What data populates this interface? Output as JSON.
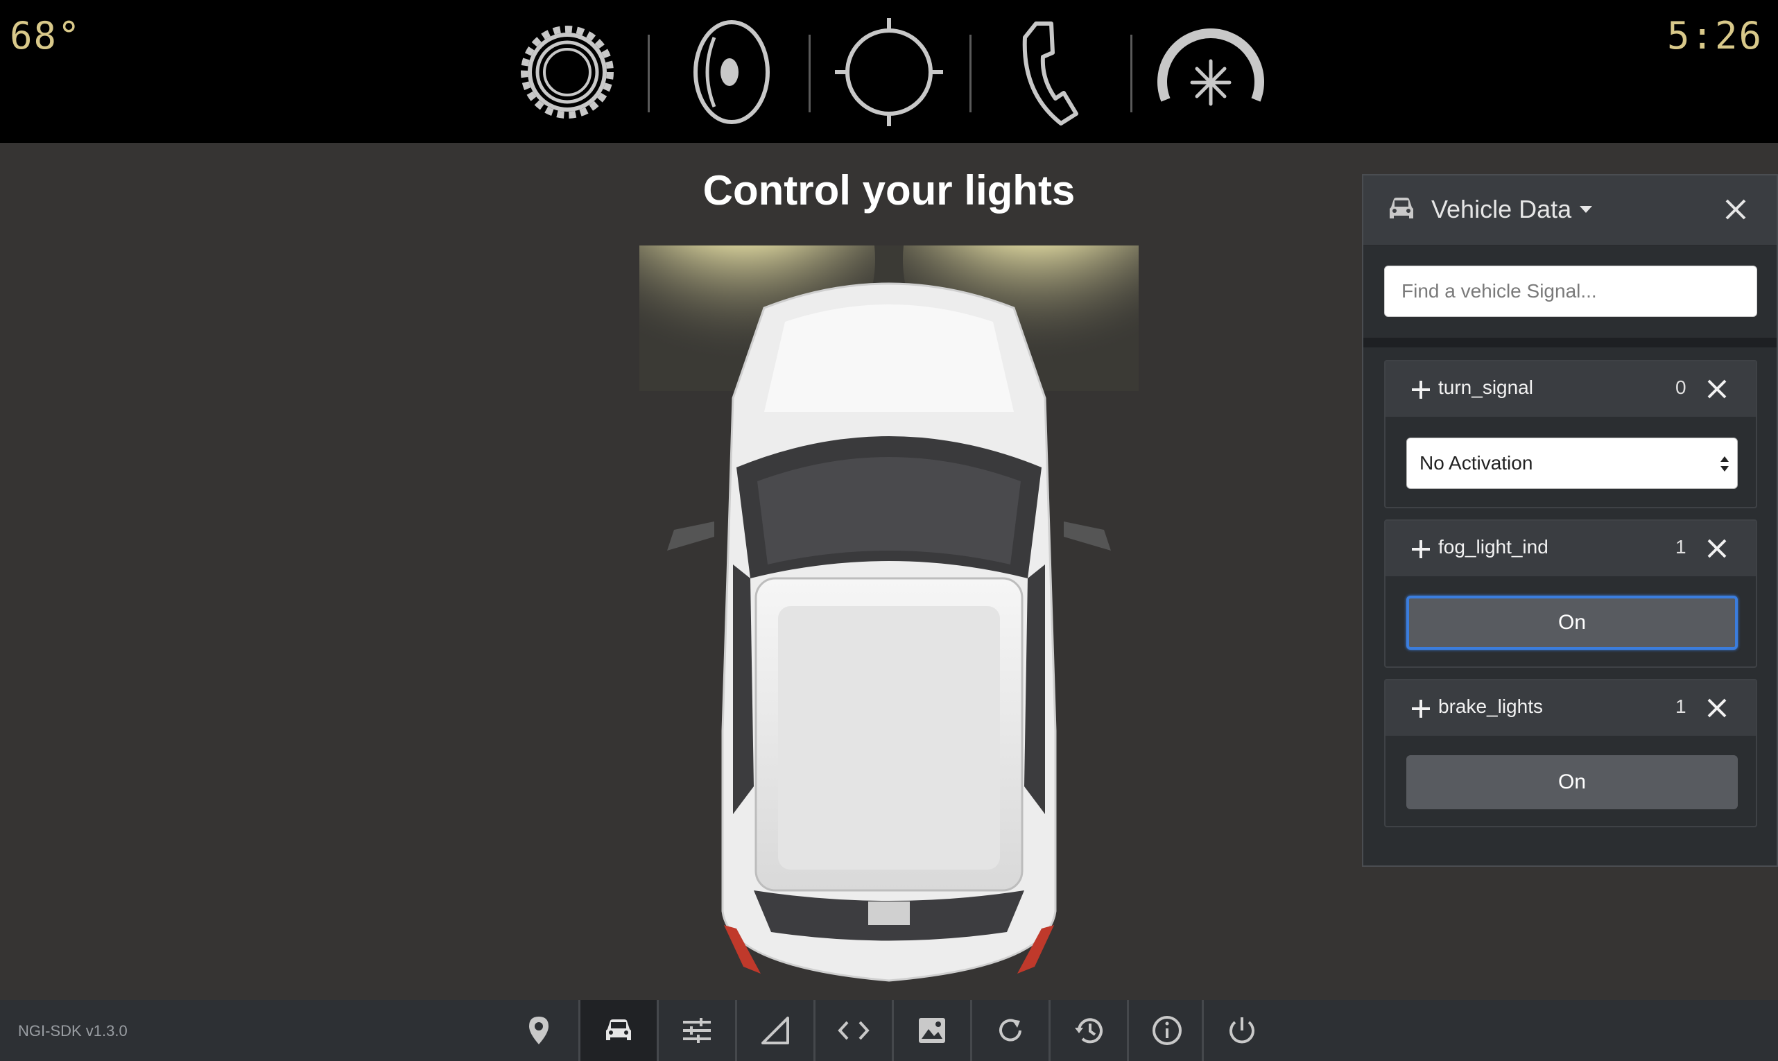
{
  "status": {
    "temperature": "68°",
    "time": "5:26"
  },
  "top_nav": [
    {
      "icon": "gear-icon"
    },
    {
      "icon": "speaker-icon"
    },
    {
      "icon": "target-icon"
    },
    {
      "icon": "phone-icon"
    },
    {
      "icon": "climate-icon"
    }
  ],
  "main": {
    "title": "Control your lights"
  },
  "panel": {
    "title": "Vehicle Data",
    "search_placeholder": "Find a vehicle Signal...",
    "signals": [
      {
        "name": "turn_signal",
        "value": "0",
        "control": "select",
        "selected": "No Activation"
      },
      {
        "name": "fog_light_ind",
        "value": "1",
        "control": "button",
        "label": "On"
      },
      {
        "name": "brake_lights",
        "value": "1",
        "control": "button",
        "label": "On"
      }
    ]
  },
  "bottom": {
    "version": "NGI-SDK v1.3.0",
    "icons": [
      "location-icon",
      "car-icon",
      "sliders-icon",
      "signal-icon",
      "code-icon",
      "image-icon",
      "refresh-icon",
      "history-icon",
      "info-icon",
      "power-icon"
    ]
  },
  "colors": {
    "accent_text": "#d9c98a",
    "focus_blue": "#3b7ddd",
    "panel_bg": "#2b2e31",
    "page_bg": "#363433"
  }
}
